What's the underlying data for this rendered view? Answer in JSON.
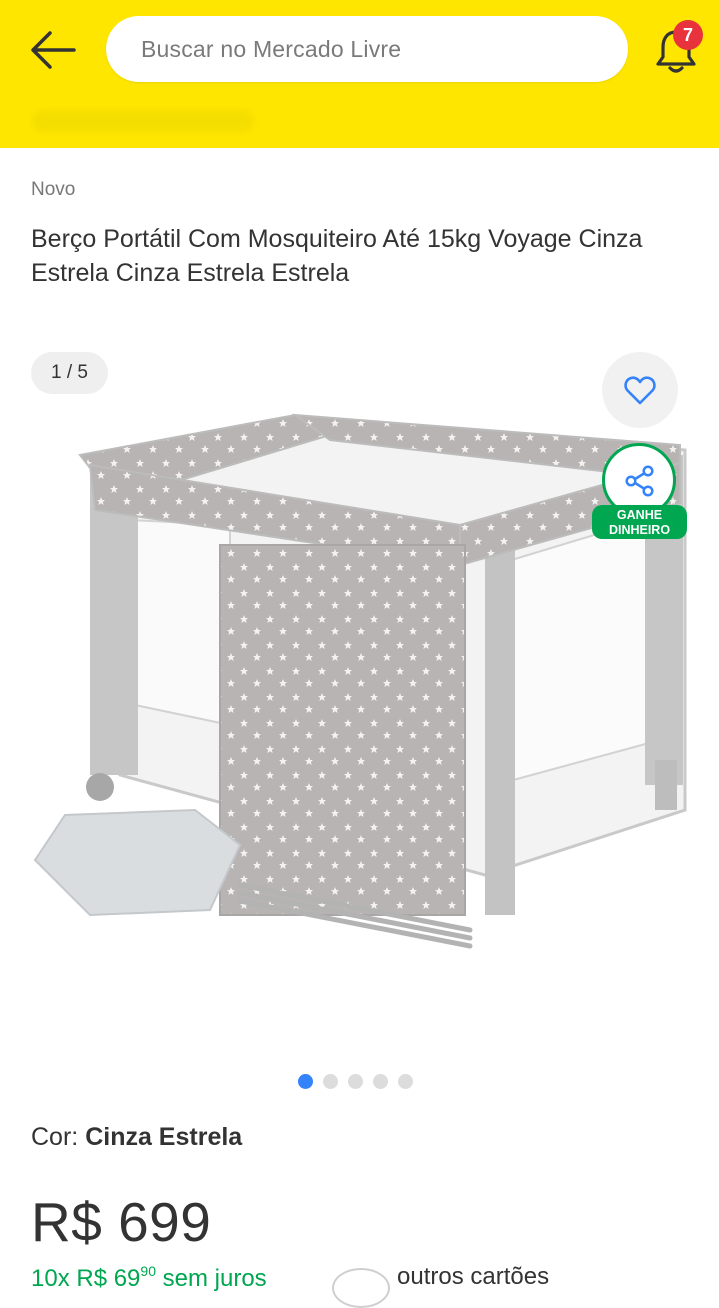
{
  "header": {
    "search_placeholder": "Buscar no Mercado Livre",
    "notification_count": "7",
    "accent_color": "#ffe600"
  },
  "product": {
    "condition": "Novo",
    "title": "Berço Portátil Com Mosquiteiro Até 15kg Voyage Cinza Estrela Cinza Estrela Estrela",
    "gallery": {
      "counter": "1 / 5",
      "total": 5,
      "active_index": 1,
      "share_label_line1": "GANHE",
      "share_label_line2": "DINHEIRO"
    },
    "color_label": "Cor:",
    "color_value": "Cinza Estrela",
    "price": "R$ 699",
    "installments_prefix": "10x R$ 69",
    "installments_cents": "90",
    "installments_suffix": " sem juros",
    "other_cards": "outros cartões"
  },
  "colors": {
    "green": "#00a650",
    "blue": "#3483fa",
    "badge_red": "#e8323c"
  },
  "icons": {
    "back": "arrow-left-icon",
    "notifications": "bell-icon",
    "favorite": "heart-icon",
    "share": "share-icon"
  }
}
